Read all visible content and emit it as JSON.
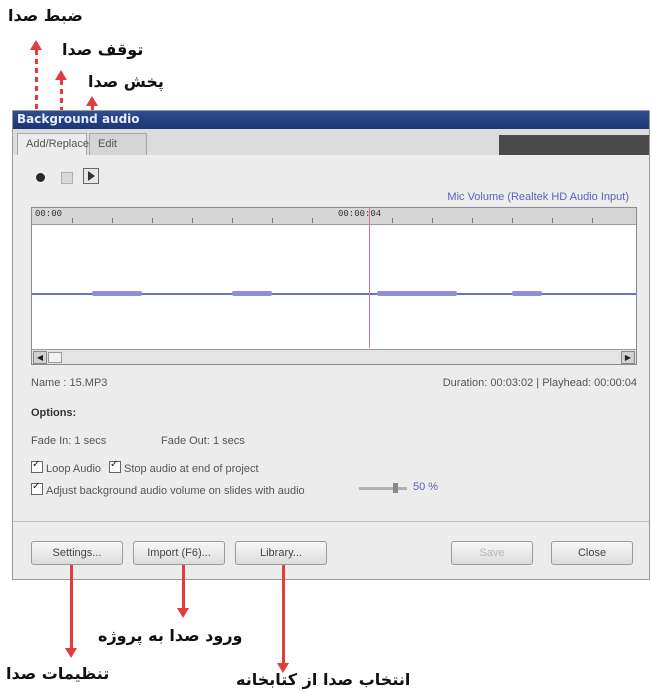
{
  "annotations": {
    "record": "ضبط صدا",
    "stop": "توقف صدا",
    "play": "پخش صدا",
    "settings": "تنظیمات صدا",
    "import": "ورود صدا به پروژه",
    "library": "انتخاب صدا از کتابخانه"
  },
  "window": {
    "title": "Background audio",
    "tabs": [
      "Add/Replace",
      "Edit"
    ],
    "mic_source": "Mic Volume (Realtek HD Audio Input)",
    "ruler": [
      "00:00",
      "00:00:04"
    ],
    "name_label": "Name : 15.MP3",
    "duration_label": "Duration: 00:03:02 | Playhead: 00:00:04",
    "options_heading": "Options:",
    "fade_in": "Fade In: 1 secs",
    "fade_out": "Fade Out: 1 secs",
    "loop_audio": "Loop Audio",
    "stop_at_end": "Stop audio at end of project",
    "adjust_volume": "Adjust background audio volume on slides with audio",
    "volume_percent": "50 %",
    "buttons": {
      "settings": "Settings...",
      "import": "Import (F6)...",
      "library": "Library...",
      "save": "Save",
      "close": "Close"
    }
  },
  "colors": {
    "arrow": "#e53b3b",
    "wave": "#6b6fcf",
    "titlebar": "#1c3675"
  }
}
